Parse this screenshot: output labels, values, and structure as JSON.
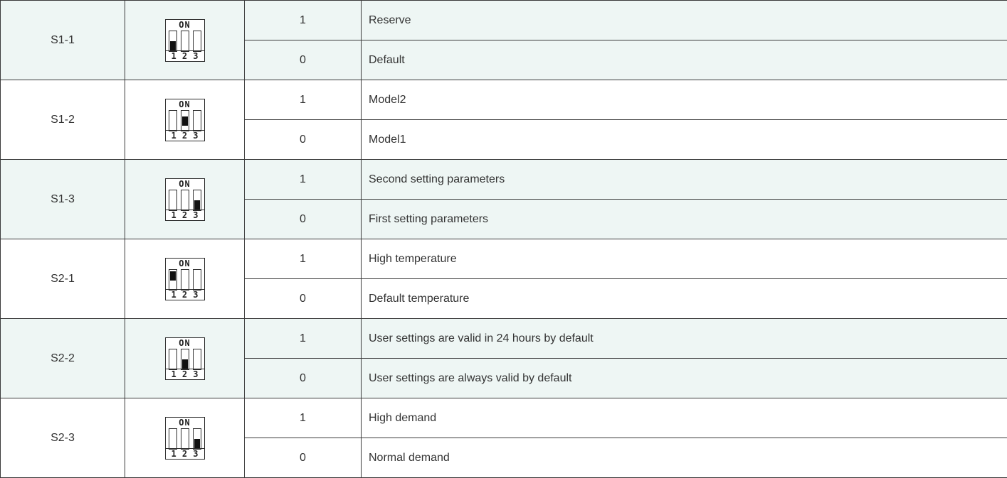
{
  "diagram": {
    "on_label": "ON",
    "positions": [
      "1",
      "2",
      "3"
    ]
  },
  "rows": [
    {
      "switch": "S1-1",
      "active_slot": 1,
      "knob": "down",
      "settings": [
        {
          "value": "1",
          "description": "Reserve"
        },
        {
          "value": "0",
          "description": "Default"
        }
      ]
    },
    {
      "switch": "S1-2",
      "active_slot": 2,
      "knob": "mid",
      "settings": [
        {
          "value": "1",
          "description": "Model2"
        },
        {
          "value": "0",
          "description": "Model1"
        }
      ]
    },
    {
      "switch": "S1-3",
      "active_slot": 3,
      "knob": "down",
      "settings": [
        {
          "value": "1",
          "description": "Second setting parameters"
        },
        {
          "value": "0",
          "description": "First setting parameters"
        }
      ]
    },
    {
      "switch": "S2-1",
      "active_slot": 1,
      "knob": "up",
      "settings": [
        {
          "value": "1",
          "description": "High temperature"
        },
        {
          "value": "0",
          "description": "Default temperature"
        }
      ]
    },
    {
      "switch": "S2-2",
      "active_slot": 2,
      "knob": "down",
      "settings": [
        {
          "value": "1",
          "description": "User settings are valid in 24 hours by default"
        },
        {
          "value": "0",
          "description": "User settings are always valid by default"
        }
      ]
    },
    {
      "switch": "S2-3",
      "active_slot": 3,
      "knob": "down",
      "settings": [
        {
          "value": "1",
          "description": "High demand"
        },
        {
          "value": "0",
          "description": "Normal demand"
        }
      ]
    }
  ],
  "colors": {
    "shaded_row": "#eef6f4",
    "plain_row": "#ffffff",
    "border": "#3a3a3a",
    "text": "#333333"
  }
}
